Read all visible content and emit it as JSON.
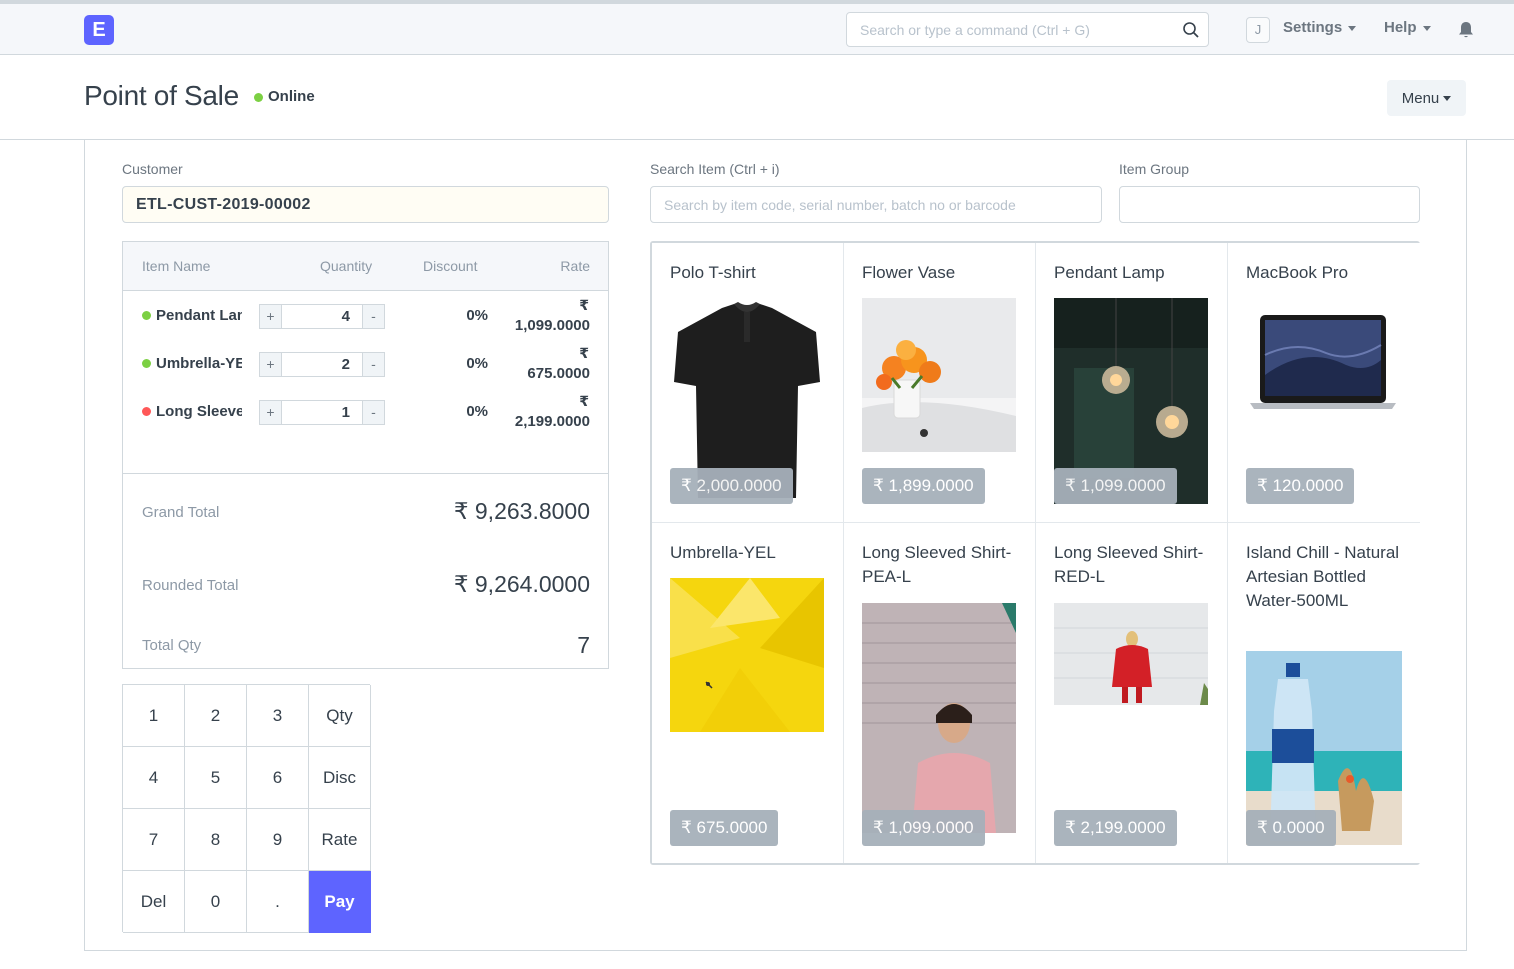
{
  "navbar": {
    "logo_letter": "E",
    "search_placeholder": "Search or type a command (Ctrl + G)",
    "avatar_letter": "J",
    "settings_label": "Settings",
    "help_label": "Help"
  },
  "page": {
    "title": "Point of Sale",
    "status": "Online",
    "menu_label": "Menu"
  },
  "customer": {
    "label": "Customer",
    "value": "ETL-CUST-2019-00002"
  },
  "item_search": {
    "label": "Search Item (Ctrl + i)",
    "placeholder": "Search by item code, serial number, batch no or barcode"
  },
  "item_group": {
    "label": "Item Group",
    "value": ""
  },
  "cart": {
    "columns": [
      "Item Name",
      "Quantity",
      "Discount",
      "Rate"
    ],
    "currency": "₹",
    "items": [
      {
        "name": "Pendant Lamp",
        "status_color": "#7cd043",
        "qty": "4",
        "discount": "0%",
        "rate": "1,099.0000"
      },
      {
        "name": "Umbrella-YEL",
        "status_color": "#7cd043",
        "qty": "2",
        "discount": "0%",
        "rate": "675.0000"
      },
      {
        "name": "Long Sleeved Shirt-RED-L",
        "status_color": "#ff5858",
        "qty": "1",
        "discount": "0%",
        "rate": "2,199.0000"
      }
    ],
    "plus": "+",
    "minus": "-",
    "totals": {
      "grand_total_label": "Grand Total",
      "grand_total": "₹ 9,263.8000",
      "rounded_total_label": "Rounded Total",
      "rounded_total": "₹ 9,264.0000",
      "total_qty_label": "Total Qty",
      "total_qty": "7"
    }
  },
  "keypad": {
    "keys": [
      "1",
      "2",
      "3",
      "Qty",
      "4",
      "5",
      "6",
      "Disc",
      "7",
      "8",
      "9",
      "Rate",
      "Del",
      "0",
      ".",
      "Pay"
    ]
  },
  "items": [
    {
      "name": "Polo T-shirt",
      "price": "₹ 2,000.0000"
    },
    {
      "name": "Flower Vase",
      "price": "₹ 1,899.0000"
    },
    {
      "name": "Pendant Lamp",
      "price": "₹ 1,099.0000"
    },
    {
      "name": "MacBook Pro",
      "price": "₹ 120.0000"
    },
    {
      "name": "Umbrella-YEL",
      "price": "₹ 675.0000"
    },
    {
      "name": "Long Sleeved Shirt-PEA-L",
      "price": "₹ 1,099.0000"
    },
    {
      "name": "Long Sleeved Shirt-RED-L",
      "price": "₹ 2,199.0000"
    },
    {
      "name": "Island Chill - Natural Artesian Bottled Water-500ML",
      "price": "₹ 0.0000"
    }
  ],
  "colors": {
    "brand": "#5e64ff",
    "online": "#7cd043",
    "out_of_stock": "#ff5858"
  }
}
